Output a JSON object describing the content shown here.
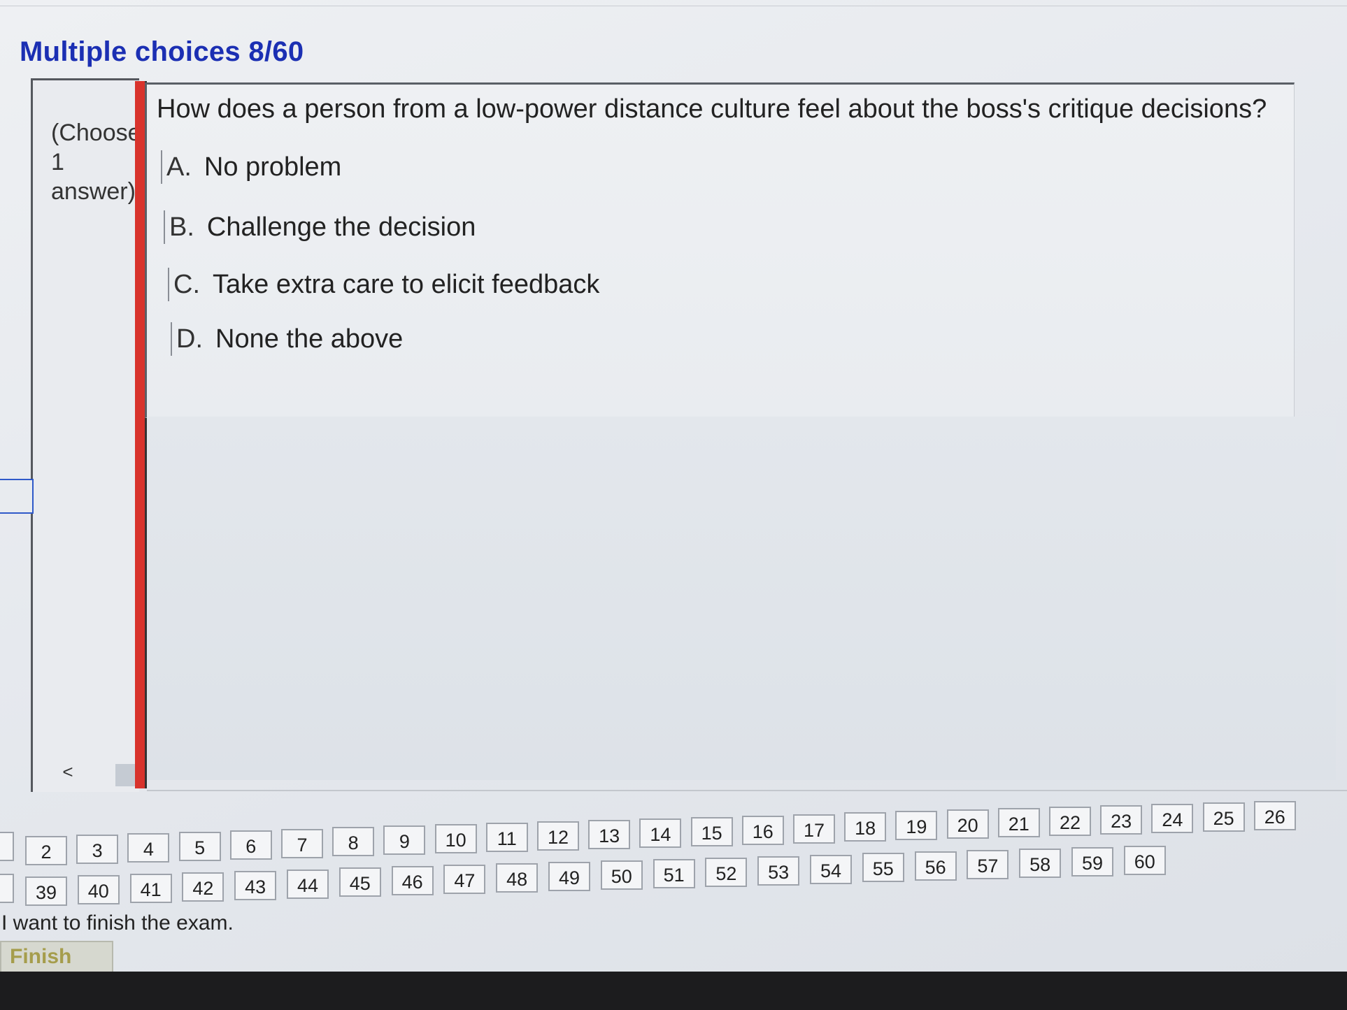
{
  "header": {
    "title": "Multiple choices 8/60"
  },
  "question": {
    "instruction": "(Choose 1 answer)",
    "text": "How does a person from a low-power distance culture feel about the boss's critique decisions?",
    "answers": [
      {
        "letter": "A.",
        "text": "No problem"
      },
      {
        "letter": "B.",
        "text": "Challenge the decision"
      },
      {
        "letter": "C.",
        "text": "Take extra care to elicit feedback"
      },
      {
        "letter": "D.",
        "text": "None the above"
      }
    ]
  },
  "scroll": {
    "left": "<",
    "right": ">"
  },
  "navigation": {
    "row1": [
      "2",
      "3",
      "4",
      "5",
      "6",
      "7",
      "8",
      "9",
      "10",
      "11",
      "12",
      "13",
      "14",
      "15",
      "16",
      "17",
      "18",
      "19",
      "20",
      "21",
      "22",
      "23",
      "24",
      "25",
      "26"
    ],
    "row2": [
      "39",
      "40",
      "41",
      "42",
      "43",
      "44",
      "45",
      "46",
      "47",
      "48",
      "49",
      "50",
      "51",
      "52",
      "53",
      "54",
      "55",
      "56",
      "57",
      "58",
      "59",
      "60"
    ]
  },
  "footer": {
    "finish_message": "I want to finish the exam.",
    "finish_label": "Finish"
  }
}
